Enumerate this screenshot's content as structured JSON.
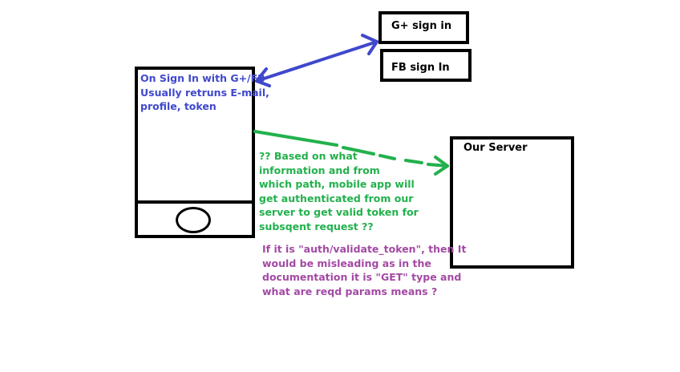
{
  "colors": {
    "outline": "#000000",
    "blue": "#3f48cc",
    "green": "#22b14c",
    "purple": "#a349a4"
  },
  "phone": {
    "text": "On Sign In with G+/FB\nUsually retruns E-mail,\nprofile,  token"
  },
  "gplus": {
    "label": "G+ sign in"
  },
  "fb": {
    "label": "FB sign In"
  },
  "server": {
    "label": "Our Server"
  },
  "notes": {
    "green": "?? Based on what\ninformation and from\nwhich path, mobile app will\nget authenticated from our\nserver to get valid token for\nsubsqent request ??",
    "purple": "If it is \"auth/validate_token\", then It\nwould be misleading as in the\ndocumentation it is \"GET\" type and\nwhat are reqd params means ?"
  }
}
